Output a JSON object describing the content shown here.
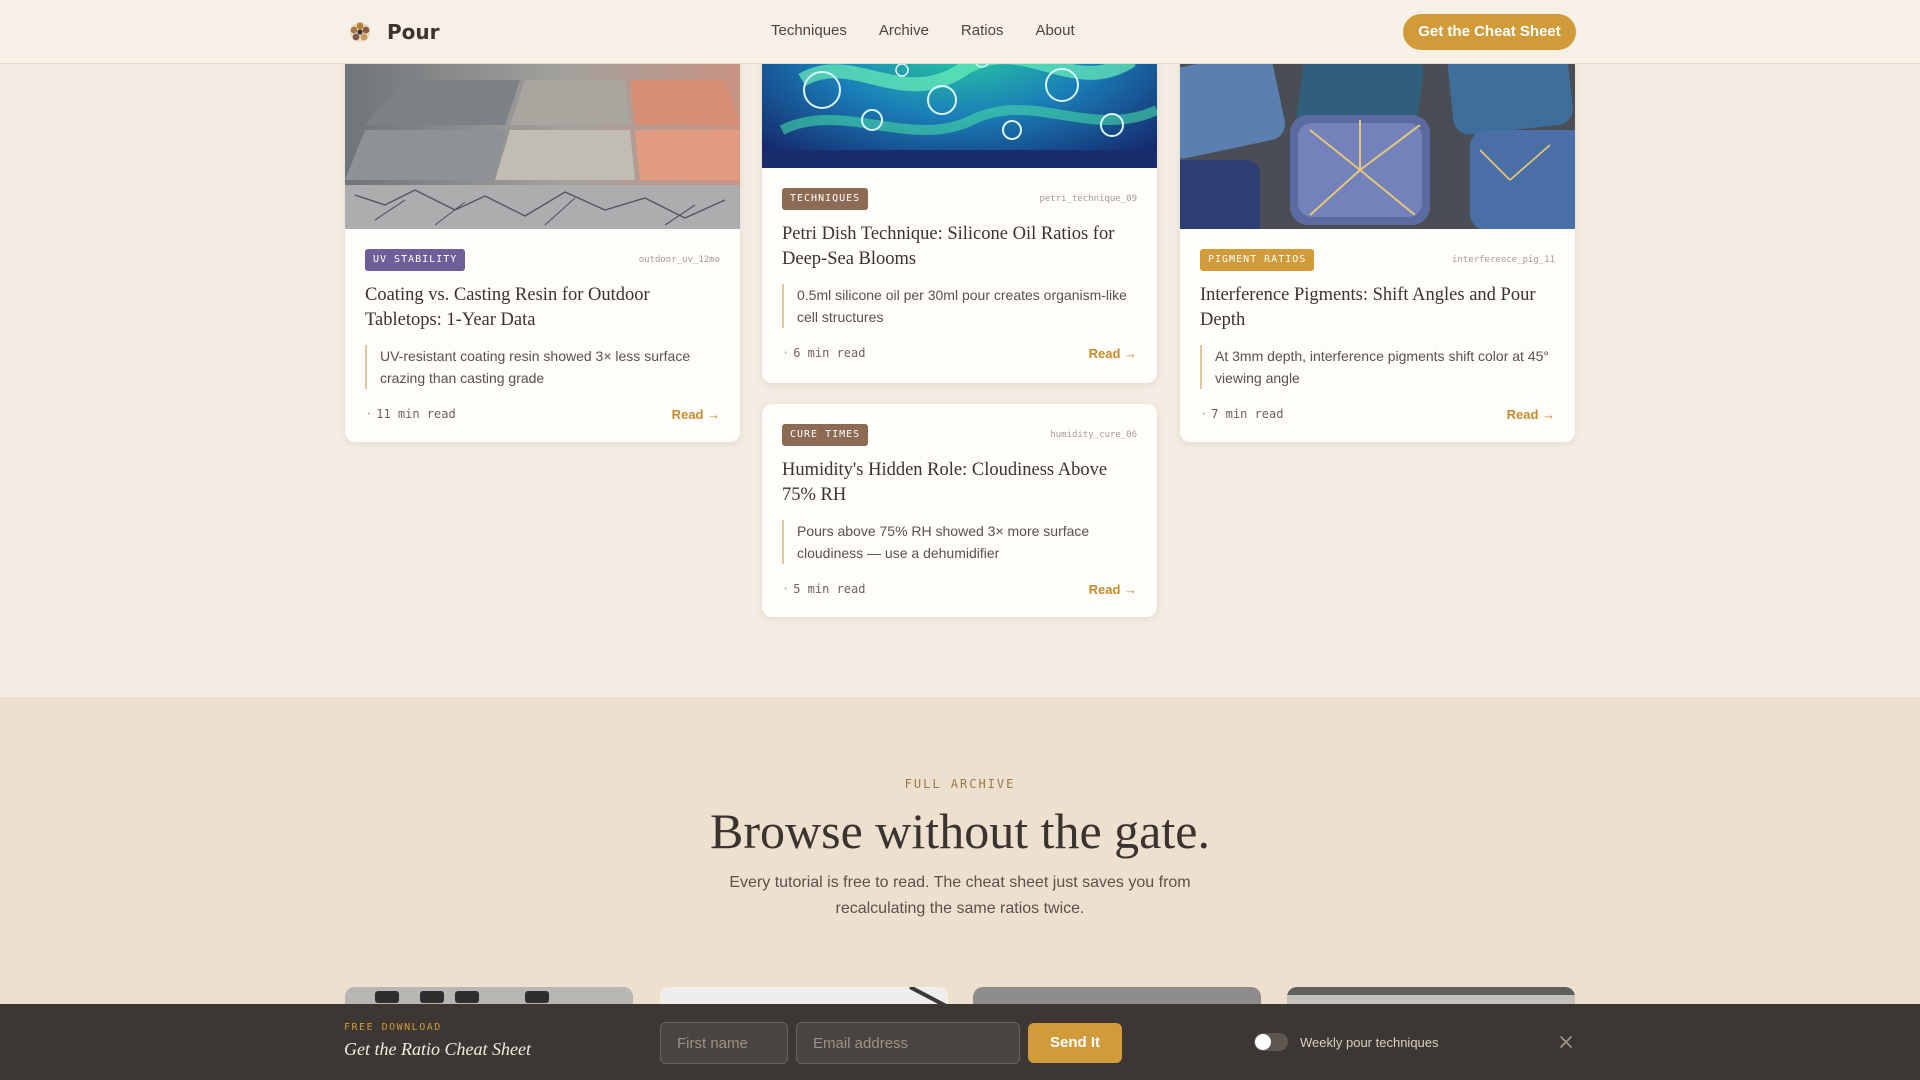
{
  "header": {
    "brand": "Pour",
    "nav": [
      "Techniques",
      "Archive",
      "Ratios",
      "About"
    ],
    "cta": "Get the Cheat Sheet"
  },
  "cards": [
    {
      "tag": "UV STABILITY",
      "tag_color": "#6f5f98",
      "slug": "outdoor_uv_12mo",
      "title": "Coating vs. Casting Resin for Outdoor Tabletops: 1-Year Data",
      "excerpt": "UV-resistant coating resin showed 3× less surface crazing than casting grade",
      "read_time": "11 min read",
      "read_label": "Read →"
    },
    {
      "tag": "TECHNIQUES",
      "tag_color": "#8c6a54",
      "slug": "petri_technique_09",
      "title": "Petri Dish Technique: Silicone Oil Ratios for Deep-Sea Blooms",
      "excerpt": "0.5ml silicone oil per 30ml pour creates organism-like cell structures",
      "read_time": "6 min read",
      "read_label": "Read →"
    },
    {
      "tag": "CURE TIMES",
      "tag_color": "#8c6a54",
      "slug": "humidity_cure_06",
      "title": "Humidity's Hidden Role: Cloudiness Above 75% RH",
      "excerpt": "Pours above 75% RH showed 3× more surface cloudiness — use a dehumidifier",
      "read_time": "5 min read",
      "read_label": "Read →"
    },
    {
      "tag": "PIGMENT RATIOS",
      "tag_color": "#d19b3a",
      "slug": "interference_pig_11",
      "title": "Interference Pigments: Shift Angles and Pour Depth",
      "excerpt": "At 3mm depth, interference pigments shift color at 45° viewing angle",
      "read_time": "7 min read",
      "read_label": "Read →"
    }
  ],
  "archive": {
    "kicker": "FULL ARCHIVE",
    "title": "Browse without the gate.",
    "subtitle": "Every tutorial is free to read. The cheat sheet just saves you from recalculating the same ratios twice."
  },
  "signup_bar": {
    "kicker": "FREE DOWNLOAD",
    "title": "Get the Ratio Cheat Sheet",
    "first_name_placeholder": "First name",
    "email_placeholder": "Email address",
    "submit": "Send It",
    "toggle_label": "Weekly pour techniques",
    "toggle_on": false
  },
  "colors": {
    "accent": "#d19b3a",
    "background": "#f4ede3",
    "archive_bg": "#ede0cf",
    "bar_bg": "#3d3734"
  }
}
